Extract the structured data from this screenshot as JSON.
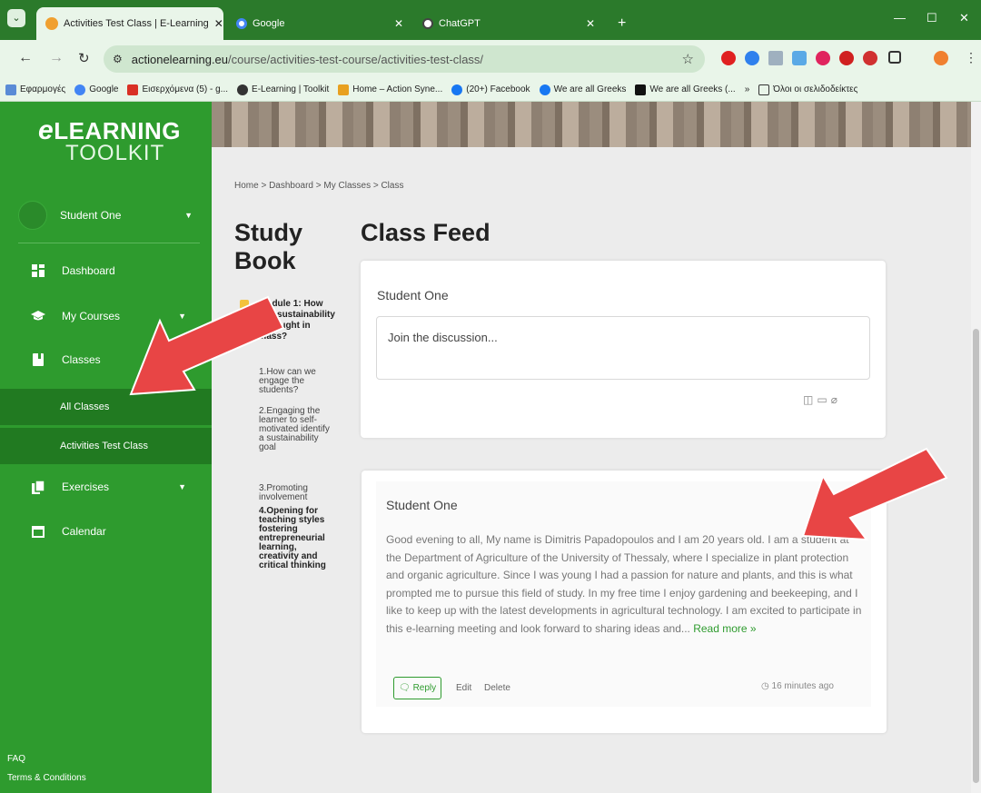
{
  "browser": {
    "tabs": [
      {
        "title": "Activities Test Class | E-Learning",
        "active": true
      },
      {
        "title": "Google",
        "active": false
      },
      {
        "title": "ChatGPT",
        "active": false
      }
    ],
    "new_tab_label": "+",
    "url_host": "actionelearning.eu",
    "url_path": "/course/activities-test-course/activities-test-class/",
    "bookmarks": [
      "Εφαρμογές",
      "Google",
      "Εισερχόμενα (5) - g...",
      "E-Learning | Toolkit",
      "Home – Action Syne...",
      "(20+) Facebook",
      "We are all Greeks",
      "We are all Greeks (...",
      "»",
      "Όλοι οι σελιδοδείκτες"
    ]
  },
  "sidebar": {
    "logo_line1": "LEARNING",
    "logo_e": "e",
    "logo_line2": "TOOLKIT",
    "user_name": "Student One",
    "items": [
      {
        "label": "Dashboard",
        "icon": "dashboard-icon"
      },
      {
        "label": "My Courses",
        "icon": "graduation-cap-icon"
      },
      {
        "label": "Classes",
        "icon": "book-icon"
      },
      {
        "label": "All Classes"
      },
      {
        "label": "Activities Test Class"
      },
      {
        "label": "Exercises",
        "icon": "copy-icon"
      },
      {
        "label": "Calendar",
        "icon": "calendar-icon"
      }
    ],
    "footer": {
      "faq": "FAQ",
      "terms": "Terms & Conditions"
    }
  },
  "breadcrumb": "Home  >  Dashboard  >  My Classes  >  Class",
  "study_book": {
    "title_line1": "Study",
    "title_line2": "Book",
    "module_title": "Module 1: How can sustainability be taught in class?",
    "lessons": [
      "1.How can we engage the students?",
      "2.Engaging the learner to self-motivated identify a sustainability goal",
      "3.Promoting involvement",
      "4.Opening for teaching styles fostering entrepreneurial learning, creativity and critical thinking"
    ]
  },
  "class_feed": {
    "title": "Class Feed",
    "composer": {
      "user_name": "Student One",
      "placeholder": "Join the discussion..."
    },
    "post": {
      "author": "Student One",
      "body": "Good evening to all, My name is Dimitris Papadopoulos and I am 20 years old. I am a student at the Department of Agriculture of the University of Thessaly, where I specialize in plant protection and organic agriculture. Since I was young I had a passion for nature and plants, and this is what prompted me to pursue this field of study. In my free time I enjoy gardening and beekeeping, and I like to keep up with the latest developments in agricultural technology. I am excited to participate in this e-learning meeting and look forward to sharing ideas and...",
      "read_more": "Read more »",
      "reply_label": "Reply",
      "edit_label": "Edit",
      "delete_label": "Delete",
      "time": "16 minutes ago"
    }
  },
  "colors": {
    "brand_green": "#2e9b2e",
    "sidebar_active": "#217a21",
    "arrow_red": "#e84545"
  }
}
